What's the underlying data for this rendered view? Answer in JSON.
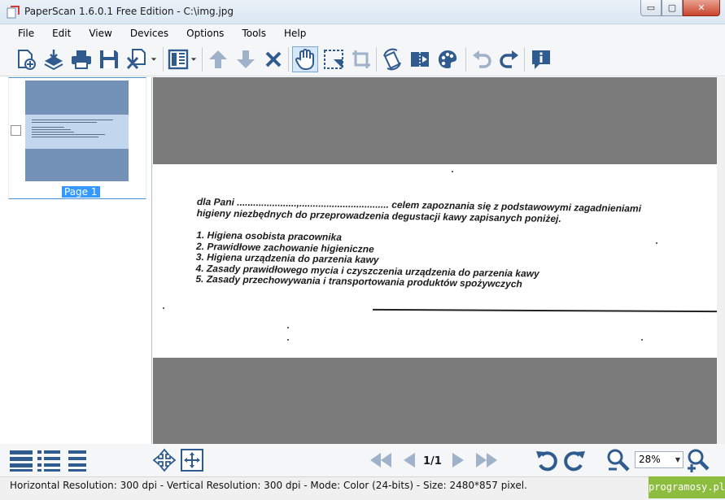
{
  "window": {
    "title": "PaperScan 1.6.0.1 Free Edition - C:\\img.jpg",
    "min_glyph": "▭",
    "max_glyph": "▢",
    "close_glyph": "✕"
  },
  "menu": [
    "File",
    "Edit",
    "View",
    "Devices",
    "Options",
    "Tools",
    "Help"
  ],
  "toolbar_icons": [
    "new-document-icon",
    "import-icon",
    "print-icon",
    "save-icon",
    "close-document-icon",
    "layout-icon",
    "move-up-icon",
    "move-down-icon",
    "delete-icon",
    "hand-tool-icon",
    "selection-icon",
    "crop-icon",
    "rotate-icon",
    "filter-icon",
    "color-palette-icon",
    "undo-icon",
    "redo-icon",
    "info-icon"
  ],
  "thumbnails": [
    {
      "label": "Page 1",
      "checked": false
    }
  ],
  "document": {
    "lines": [
      "dla Pani ......................,................................. celem zapoznania się z podstawowymi  zagadnieniami",
      "higieny niezbędnych do przeprowadzenia degustacji kawy zapisanych poniżej.",
      "1. Higiena osobista pracownika",
      "2. Prawidłowe zachowanie higieniczne",
      "3. Higiena urządzenia do parzenia kawy",
      "4. Zasady prawidłowego mycia i czyszczenia urządzenia do parzenia kawy",
      "5. Zasady przechowywania i transportowania produktów spożywczych"
    ]
  },
  "navigation": {
    "page_indicator": "1/1"
  },
  "zoom": {
    "value": "28%"
  },
  "status": {
    "text": "Horizontal Resolution:  300 dpi - Vertical Resolution:  300 dpi - Mode: Color (24-bits) - Size: 2480*857 pixel."
  },
  "watermark": "programosy.pl",
  "colors": {
    "icon_blue": "#2f5b8f",
    "accent": "#3399ff"
  }
}
